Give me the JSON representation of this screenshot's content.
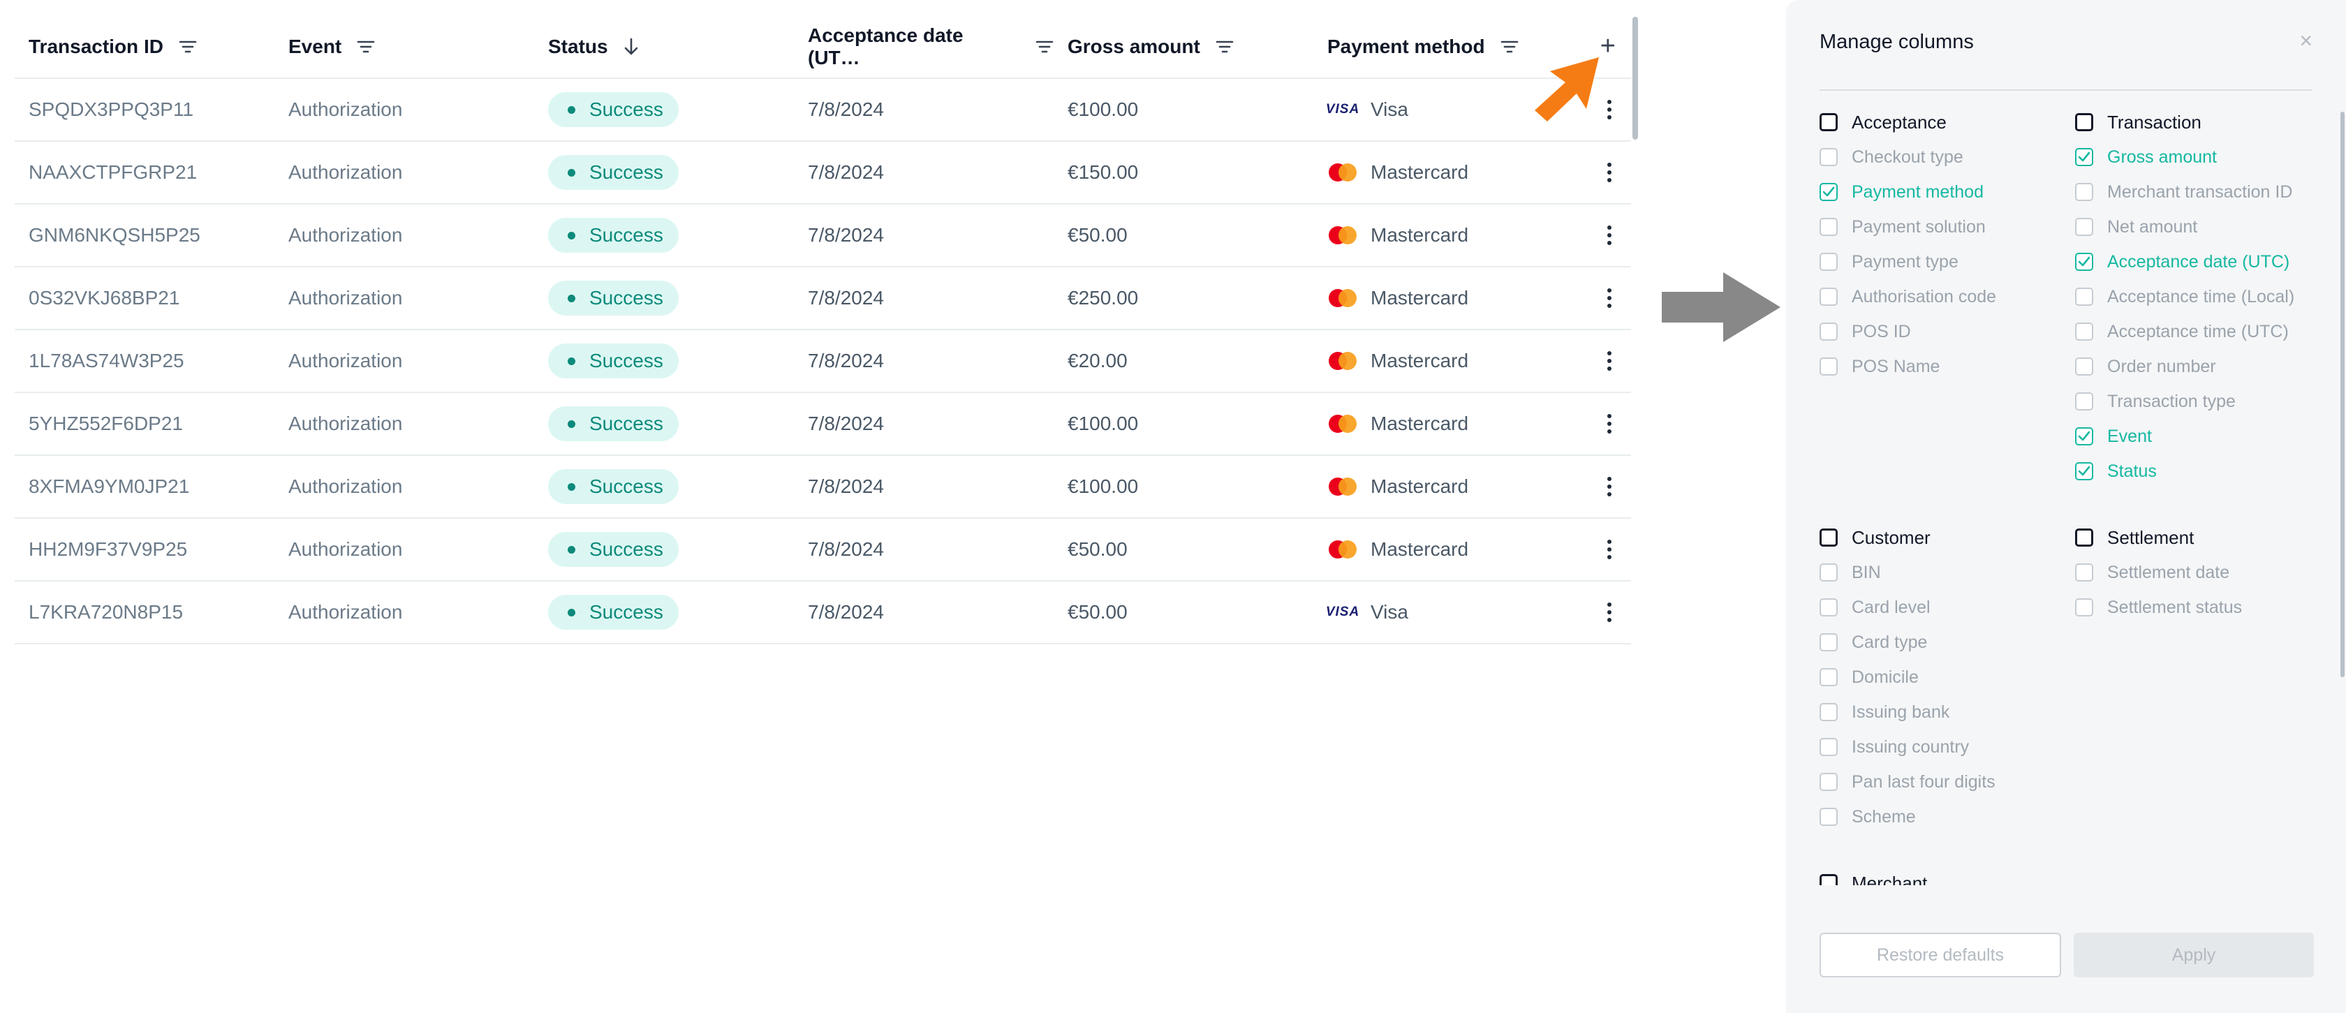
{
  "table": {
    "headers": {
      "transaction_id": "Transaction ID",
      "event": "Event",
      "status": "Status",
      "acceptance_date": "Acceptance date (UT…",
      "gross_amount": "Gross amount",
      "payment_method": "Payment method"
    },
    "add_column_label": "+",
    "rows": [
      {
        "id": "SPQDX3PPQ3P11",
        "event": "Authorization",
        "status": "Success",
        "date": "7/8/2024",
        "amount": "€100.00",
        "method": "Visa",
        "brand": "VISA"
      },
      {
        "id": "NAAXCTPFGRP21",
        "event": "Authorization",
        "status": "Success",
        "date": "7/8/2024",
        "amount": "€150.00",
        "method": "Mastercard",
        "brand": ""
      },
      {
        "id": "GNM6NKQSH5P25",
        "event": "Authorization",
        "status": "Success",
        "date": "7/8/2024",
        "amount": "€50.00",
        "method": "Mastercard",
        "brand": ""
      },
      {
        "id": "0S32VKJ68BP21",
        "event": "Authorization",
        "status": "Success",
        "date": "7/8/2024",
        "amount": "€250.00",
        "method": "Mastercard",
        "brand": ""
      },
      {
        "id": "1L78AS74W3P25",
        "event": "Authorization",
        "status": "Success",
        "date": "7/8/2024",
        "amount": "€20.00",
        "method": "Mastercard",
        "brand": ""
      },
      {
        "id": "5YHZ552F6DP21",
        "event": "Authorization",
        "status": "Success",
        "date": "7/8/2024",
        "amount": "€100.00",
        "method": "Mastercard",
        "brand": ""
      },
      {
        "id": "8XFMA9YM0JP21",
        "event": "Authorization",
        "status": "Success",
        "date": "7/8/2024",
        "amount": "€100.00",
        "method": "Mastercard",
        "brand": ""
      },
      {
        "id": "HH2M9F37V9P25",
        "event": "Authorization",
        "status": "Success",
        "date": "7/8/2024",
        "amount": "€50.00",
        "method": "Mastercard",
        "brand": ""
      },
      {
        "id": "L7KRA720N8P15",
        "event": "Authorization",
        "status": "Success",
        "date": "7/8/2024",
        "amount": "€50.00",
        "method": "Visa",
        "brand": "VISA"
      }
    ]
  },
  "panel": {
    "title": "Manage columns",
    "close": "×",
    "groups": {
      "acceptance": {
        "label": "Acceptance",
        "items": [
          {
            "label": "Checkout type",
            "checked": false
          },
          {
            "label": "Payment method",
            "checked": true
          },
          {
            "label": "Payment solution",
            "checked": false
          },
          {
            "label": "Payment type",
            "checked": false
          },
          {
            "label": "Authorisation code",
            "checked": false
          },
          {
            "label": "POS ID",
            "checked": false
          },
          {
            "label": "POS Name",
            "checked": false
          }
        ]
      },
      "transaction": {
        "label": "Transaction",
        "items": [
          {
            "label": "Gross amount",
            "checked": true
          },
          {
            "label": "Merchant transaction ID",
            "checked": false
          },
          {
            "label": "Net amount",
            "checked": false
          },
          {
            "label": "Acceptance date (UTC)",
            "checked": true
          },
          {
            "label": "Acceptance time (Local)",
            "checked": false
          },
          {
            "label": "Acceptance time (UTC)",
            "checked": false
          },
          {
            "label": "Order number",
            "checked": false
          },
          {
            "label": "Transaction type",
            "checked": false
          },
          {
            "label": "Event",
            "checked": true
          },
          {
            "label": "Status",
            "checked": true
          }
        ]
      },
      "customer": {
        "label": "Customer",
        "items": [
          {
            "label": "BIN",
            "checked": false
          },
          {
            "label": "Card level",
            "checked": false
          },
          {
            "label": "Card type",
            "checked": false
          },
          {
            "label": "Domicile",
            "checked": false
          },
          {
            "label": "Issuing bank",
            "checked": false
          },
          {
            "label": "Issuing country",
            "checked": false
          },
          {
            "label": "Pan last four digits",
            "checked": false
          },
          {
            "label": "Scheme",
            "checked": false
          }
        ]
      },
      "settlement": {
        "label": "Settlement",
        "items": [
          {
            "label": "Settlement date",
            "checked": false
          },
          {
            "label": "Settlement status",
            "checked": false
          }
        ]
      },
      "merchant": {
        "label": "Merchant",
        "items": []
      }
    },
    "restore_label": "Restore defaults",
    "apply_label": "Apply"
  },
  "colors": {
    "accent": "#15b8a2",
    "badge_bg": "#dcf7f3",
    "badge_fg": "#0d8a7b",
    "arrow_orange": "#f57c14",
    "arrow_gray": "#888888"
  }
}
